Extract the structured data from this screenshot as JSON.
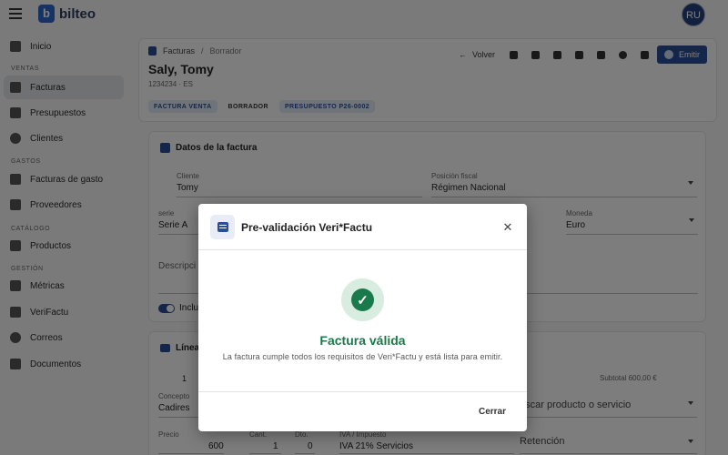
{
  "app": {
    "brand": "bilteo",
    "brand_mark": "b",
    "user_initials": "RU"
  },
  "sidebar": {
    "items": [
      {
        "label": "Inicio",
        "icon": "home-icon"
      },
      {
        "section": "VENTAS"
      },
      {
        "label": "Facturas",
        "icon": "invoice-icon",
        "active": true
      },
      {
        "label": "Presupuestos",
        "icon": "quote-icon"
      },
      {
        "label": "Clientes",
        "icon": "people-icon"
      },
      {
        "section": "GASTOS"
      },
      {
        "label": "Facturas de gasto",
        "icon": "receipt-icon"
      },
      {
        "label": "Proveedores",
        "icon": "truck-icon"
      },
      {
        "section": "CATÁLOGO"
      },
      {
        "label": "Productos",
        "icon": "tag-icon"
      },
      {
        "section": "GESTIÓN"
      },
      {
        "label": "Métricas",
        "icon": "bar-chart-icon"
      },
      {
        "label": "VeriFactu",
        "icon": "shield-icon"
      },
      {
        "label": "Correos",
        "icon": "at-icon"
      },
      {
        "label": "Documentos",
        "icon": "folder-icon"
      }
    ]
  },
  "header": {
    "breadcrumb_root": "Facturas",
    "breadcrumb_sep": "/",
    "breadcrumb_current": "Borrador",
    "title": "Saly, Tomy",
    "subtitle": "1234234 · ES",
    "back_label": "Volver",
    "emit_label": "Emitir",
    "chips": [
      "FACTURA VENTA",
      "BORRADOR",
      "PRESUPUESTO P26-0002"
    ]
  },
  "invoice_data": {
    "title": "Datos de la factura",
    "cliente_label": "Cliente",
    "cliente_value": "Tomy",
    "posicion_label": "Posición fiscal",
    "posicion_value": "Régimen Nacional",
    "serie_label": "serie",
    "serie_value": "Serie A",
    "moneda_label": "Moneda",
    "moneda_value": "Euro",
    "descripcion_placeholder": "Descripci",
    "toggle_label": "Inclui"
  },
  "lines": {
    "title": "Líneas",
    "line_number": "1",
    "subtotal_label": "Subtotal",
    "subtotal_value": "600,00 €",
    "concepto_label": "Concepto",
    "concepto_value": "Cadires",
    "buscar_placeholder": "uscar producto o servicio",
    "precio_label": "Precio",
    "precio_value": "600",
    "cant_label": "Cant.",
    "cant_value": "1",
    "dto_label": "Dto.",
    "dto_value": "0",
    "iva_label": "IVA / Impuesto",
    "iva_value": "IVA 21% Servicios",
    "retencion_placeholder": "Retención"
  },
  "dialog": {
    "title": "Pre-validación Veri*Factu",
    "close_glyph": "✕",
    "status_title": "Factura válida",
    "status_message": "La factura cumple todos los requisitos de Veri*Factu y está lista para emitir.",
    "close_button": "Cerrar",
    "success_color": "#1b7a4b"
  }
}
